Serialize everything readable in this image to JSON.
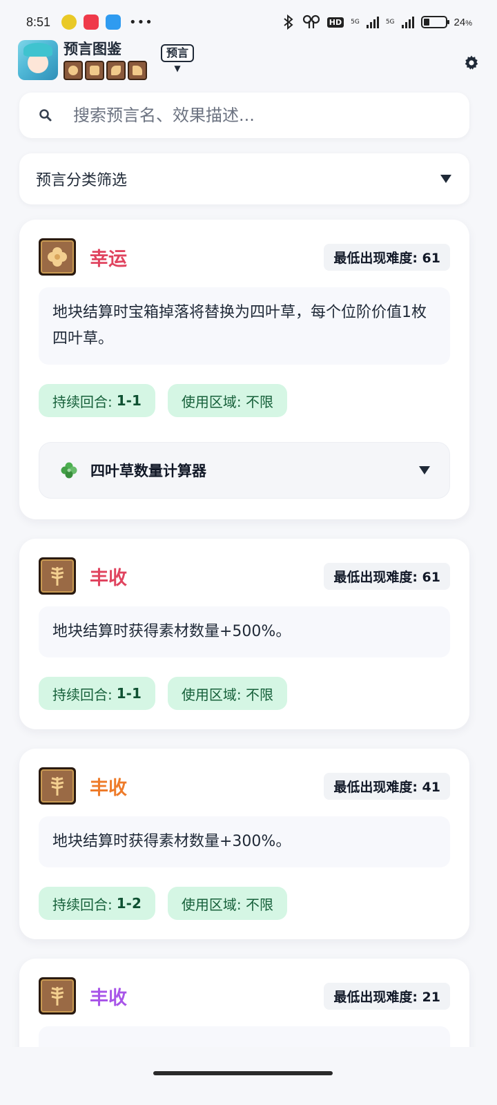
{
  "status_bar": {
    "time": "8:51",
    "more": "•••",
    "hd": "HD",
    "net1": "5G",
    "net2": "5G",
    "battery": "24",
    "battery_unit": "%"
  },
  "header": {
    "title": "预言图鉴",
    "mode": "预言",
    "mode_caret": "▼",
    "tiny_icons": [
      "clover-icon",
      "book-icon",
      "bird-icon",
      "thumb-icon"
    ]
  },
  "search": {
    "placeholder": "搜索预言名、效果描述..."
  },
  "filter": {
    "label": "预言分类筛选"
  },
  "cards": [
    {
      "name": "幸运",
      "name_color": "#e0445f",
      "icon": "clover-icon",
      "difficulty_label": "最低出现难度: ",
      "difficulty": "61",
      "description": "地块结算时宝箱掉落将替换为四叶草，每个位阶价值1枚四叶草。",
      "duration_label": "持续回合:",
      "duration": "1-1",
      "area_label": "使用区域: 不限",
      "calculator_label": "四叶草数量计算器"
    },
    {
      "name": "丰收",
      "name_color": "#e0445f",
      "icon": "wheat-icon",
      "difficulty_label": "最低出现难度: ",
      "difficulty": "61",
      "description": "地块结算时获得素材数量+500%。",
      "duration_label": "持续回合:",
      "duration": "1-1",
      "area_label": "使用区域: 不限"
    },
    {
      "name": "丰收",
      "name_color": "#ee7b2a",
      "icon": "wheat-icon",
      "difficulty_label": "最低出现难度: ",
      "difficulty": "41",
      "description": "地块结算时获得素材数量+300%。",
      "duration_label": "持续回合:",
      "duration": "1-2",
      "area_label": "使用区域: 不限"
    },
    {
      "name": "丰收",
      "name_color": "#a855e8",
      "icon": "wheat-icon",
      "difficulty_label": "最低出现难度: ",
      "difficulty": "21"
    }
  ]
}
